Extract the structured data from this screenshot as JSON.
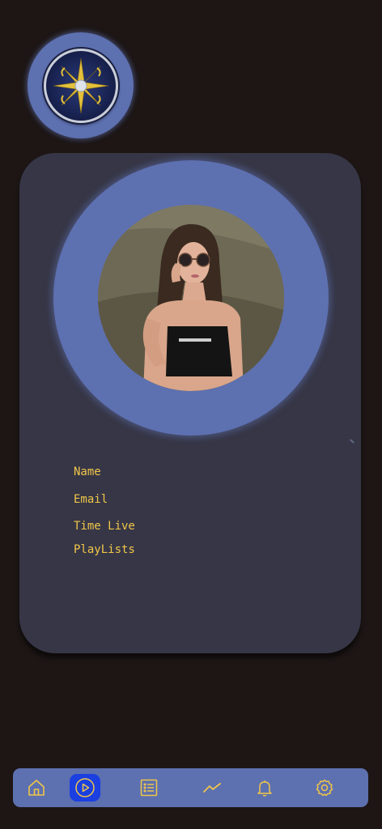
{
  "profile": {
    "fields": [
      {
        "label": "Name"
      },
      {
        "label": "Email"
      },
      {
        "label": "Time Live"
      },
      {
        "label": "PlayLists"
      }
    ]
  },
  "nav": {
    "items": [
      {
        "icon": "home-icon"
      },
      {
        "icon": "play-circle-icon",
        "active": true
      },
      {
        "icon": "list-icon"
      },
      {
        "icon": "trending-icon"
      },
      {
        "icon": "bell-icon"
      },
      {
        "icon": "settings-icon"
      }
    ]
  },
  "colors": {
    "background": "#1d1615",
    "card": "#363646",
    "accent": "#5d70b0",
    "active_nav": "#1b3fe0",
    "text": "#f0c64a",
    "icon": "#f0c64a"
  }
}
